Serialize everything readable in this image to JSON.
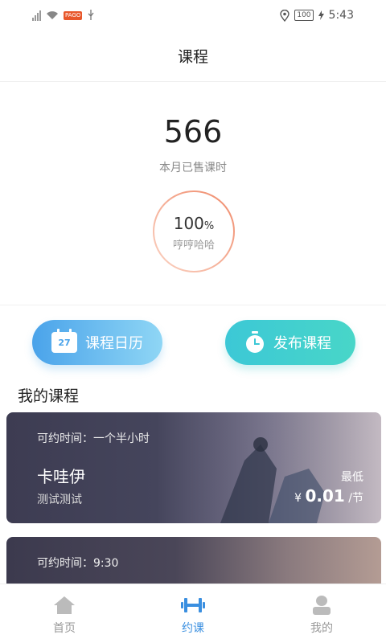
{
  "status_bar": {
    "badge_text": "PAGO",
    "battery": "100",
    "time": "5:43"
  },
  "nav": {
    "title": "课程"
  },
  "stats": {
    "sold_count": "566",
    "sold_label": "本月已售课时",
    "ring_percent_value": "100",
    "ring_percent_unit": "%",
    "ring_name": "哼哼哈哈",
    "progress": 1.0
  },
  "actions": {
    "calendar_label": "课程日历",
    "calendar_day": "27",
    "publish_label": "发布课程"
  },
  "section": {
    "my_courses_title": "我的课程"
  },
  "courses": [
    {
      "time_label": "可约时间：一个半小时",
      "name": "卡哇伊",
      "desc": "测试测试",
      "min_label": "最低",
      "currency": "¥",
      "price": "0.01",
      "unit": "/节"
    },
    {
      "time_label": "可约时间：9:30"
    }
  ],
  "tabbar": {
    "items": [
      {
        "label": "首页",
        "icon": "home-icon"
      },
      {
        "label": "约课",
        "icon": "dumbbell-icon"
      },
      {
        "label": "我的",
        "icon": "user-icon"
      }
    ]
  },
  "colors": {
    "accent": "#3a8fe0",
    "ring": "#f08a6a",
    "card_bg": "#3d3c52"
  }
}
